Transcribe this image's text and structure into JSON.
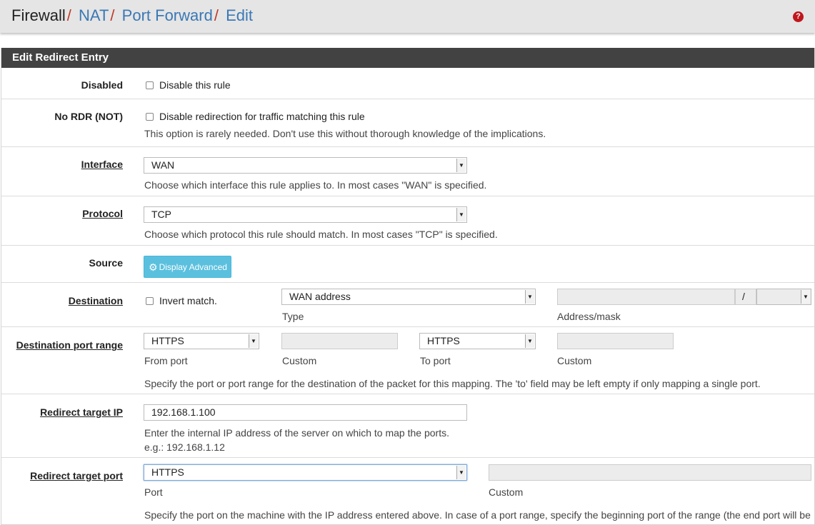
{
  "breadcrumb": {
    "items": [
      "Firewall",
      "NAT",
      "Port Forward",
      "Edit"
    ],
    "separator": "/"
  },
  "panel_title": "Edit Redirect Entry",
  "disabled": {
    "label": "Disabled",
    "checkbox_label": "Disable this rule"
  },
  "nordr": {
    "label": "No RDR (NOT)",
    "checkbox_label": "Disable redirection for traffic matching this rule",
    "help": "This option is rarely needed. Don't use this without thorough knowledge of the implications."
  },
  "interface": {
    "label": "Interface",
    "value": "WAN",
    "help": "Choose which interface this rule applies to. In most cases \"WAN\" is specified."
  },
  "protocol": {
    "label": "Protocol",
    "value": "TCP",
    "help": "Choose which protocol this rule should match. In most cases \"TCP\" is specified."
  },
  "source": {
    "label": "Source",
    "button": "Display Advanced"
  },
  "destination": {
    "label": "Destination",
    "invert_label": "Invert match.",
    "type_value": "WAN address",
    "type_caption": "Type",
    "mask_sep": "/",
    "address_caption": "Address/mask"
  },
  "dest_port": {
    "label": "Destination port range",
    "from_value": "HTTPS",
    "from_caption": "From port",
    "custom_caption_1": "Custom",
    "to_value": "HTTPS",
    "to_caption": "To port",
    "custom_caption_2": "Custom",
    "help": "Specify the port or port range for the destination of the packet for this mapping. The 'to' field may be left empty if only mapping a single port."
  },
  "redirect_ip": {
    "label": "Redirect target IP",
    "value": "192.168.1.100",
    "help": "Enter the internal IP address of the server on which to map the ports.",
    "example": "e.g.: 192.168.1.12"
  },
  "redirect_port": {
    "label": "Redirect target port",
    "value": "HTTPS",
    "port_caption": "Port",
    "custom_caption": "Custom",
    "help": "Specify the port on the machine with the IP address entered above. In case of a port range, specify the beginning port of the range (the end port will be"
  },
  "colors": {
    "accent": "#3a78b5",
    "separator": "#c0392b",
    "header": "#424242",
    "info_button": "#5bc0de"
  }
}
